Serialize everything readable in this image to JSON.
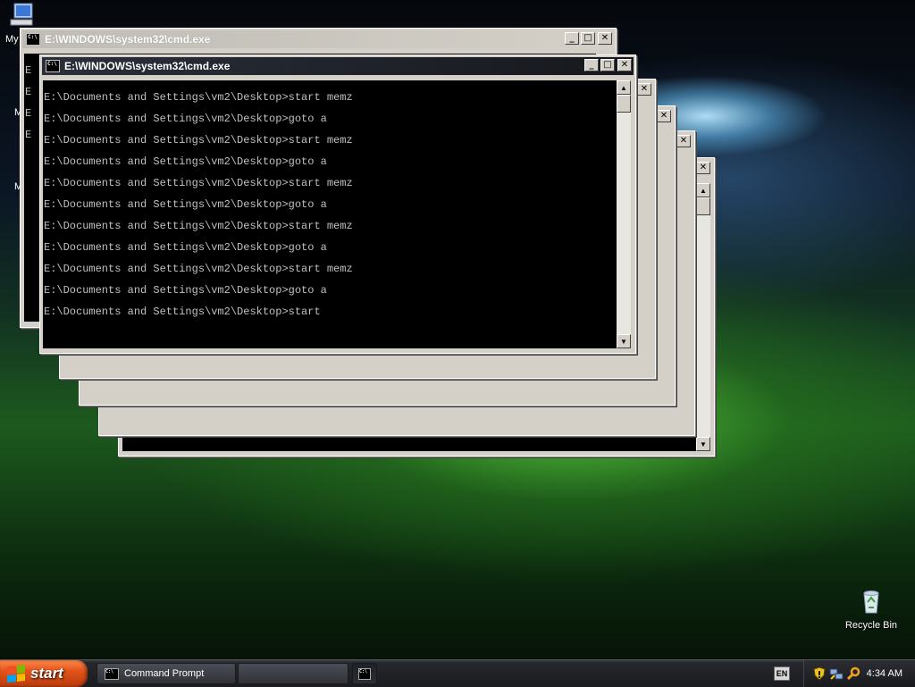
{
  "desktop": {
    "icons": [
      {
        "name": "my-computer-icon",
        "label": "My"
      },
      {
        "name": "recycle-bin-icon",
        "label": "Recycle Bin"
      }
    ],
    "left_fragments": [
      "E",
      "E",
      "E",
      "E"
    ]
  },
  "windows": [
    {
      "title": "E:\\WINDOWS\\system32\\cmd.exe",
      "state": "inactive"
    },
    {
      "title": "E:\\WINDOWS\\system32\\cmd.exe",
      "state": "active"
    }
  ],
  "console": {
    "lines": [
      "E:\\Documents and Settings\\vm2\\Desktop>start memz",
      "E:\\Documents and Settings\\vm2\\Desktop>goto a",
      "E:\\Documents and Settings\\vm2\\Desktop>start memz",
      "E:\\Documents and Settings\\vm2\\Desktop>goto a",
      "E:\\Documents and Settings\\vm2\\Desktop>start memz",
      "E:\\Documents and Settings\\vm2\\Desktop>goto a",
      "E:\\Documents and Settings\\vm2\\Desktop>start memz",
      "E:\\Documents and Settings\\vm2\\Desktop>goto a",
      "E:\\Documents and Settings\\vm2\\Desktop>start memz",
      "E:\\Documents and Settings\\vm2\\Desktop>goto a",
      "E:\\Documents and Settings\\vm2\\Desktop>start"
    ]
  },
  "taskbar": {
    "start_label": "start",
    "items": [
      {
        "label": "Command Prompt"
      },
      {
        "label": ""
      }
    ],
    "lang": "EN",
    "clock": "4:34 AM"
  },
  "icons": {
    "minimize": "minimize-icon",
    "maximize": "maximize-icon",
    "close": "close-icon"
  },
  "colors": {
    "console_bg": "#000000",
    "console_fg": "#c0c0c0",
    "start_button": "#e2531b"
  }
}
